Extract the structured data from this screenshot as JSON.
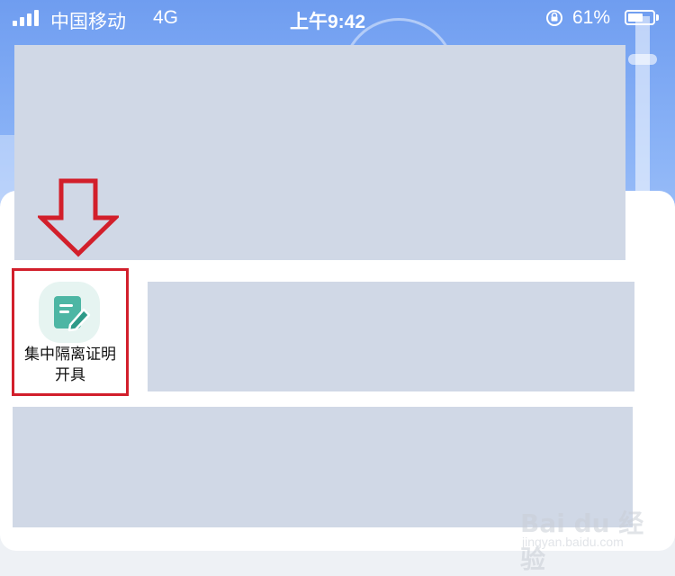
{
  "status_bar": {
    "carrier": "中国移动",
    "network": "4G",
    "time": "上午9:42",
    "battery_percent_label": "61%",
    "battery_level": 0.61
  },
  "feature": {
    "label_line1": "集中隔离证明",
    "label_line2": "开具",
    "icon": "edit-document-icon",
    "highlighted": true,
    "highlight_color": "#d21f2b"
  },
  "annotation": {
    "icon": "down-arrow-icon",
    "color": "#d21f2b"
  },
  "theme": {
    "header_blue": "#6f9df0",
    "icon_green": "#4db6a4",
    "redaction_gray": "#d0d8e6"
  },
  "watermark": {
    "brand": "Bai du 经验",
    "url": "jingyan.baidu.com"
  }
}
